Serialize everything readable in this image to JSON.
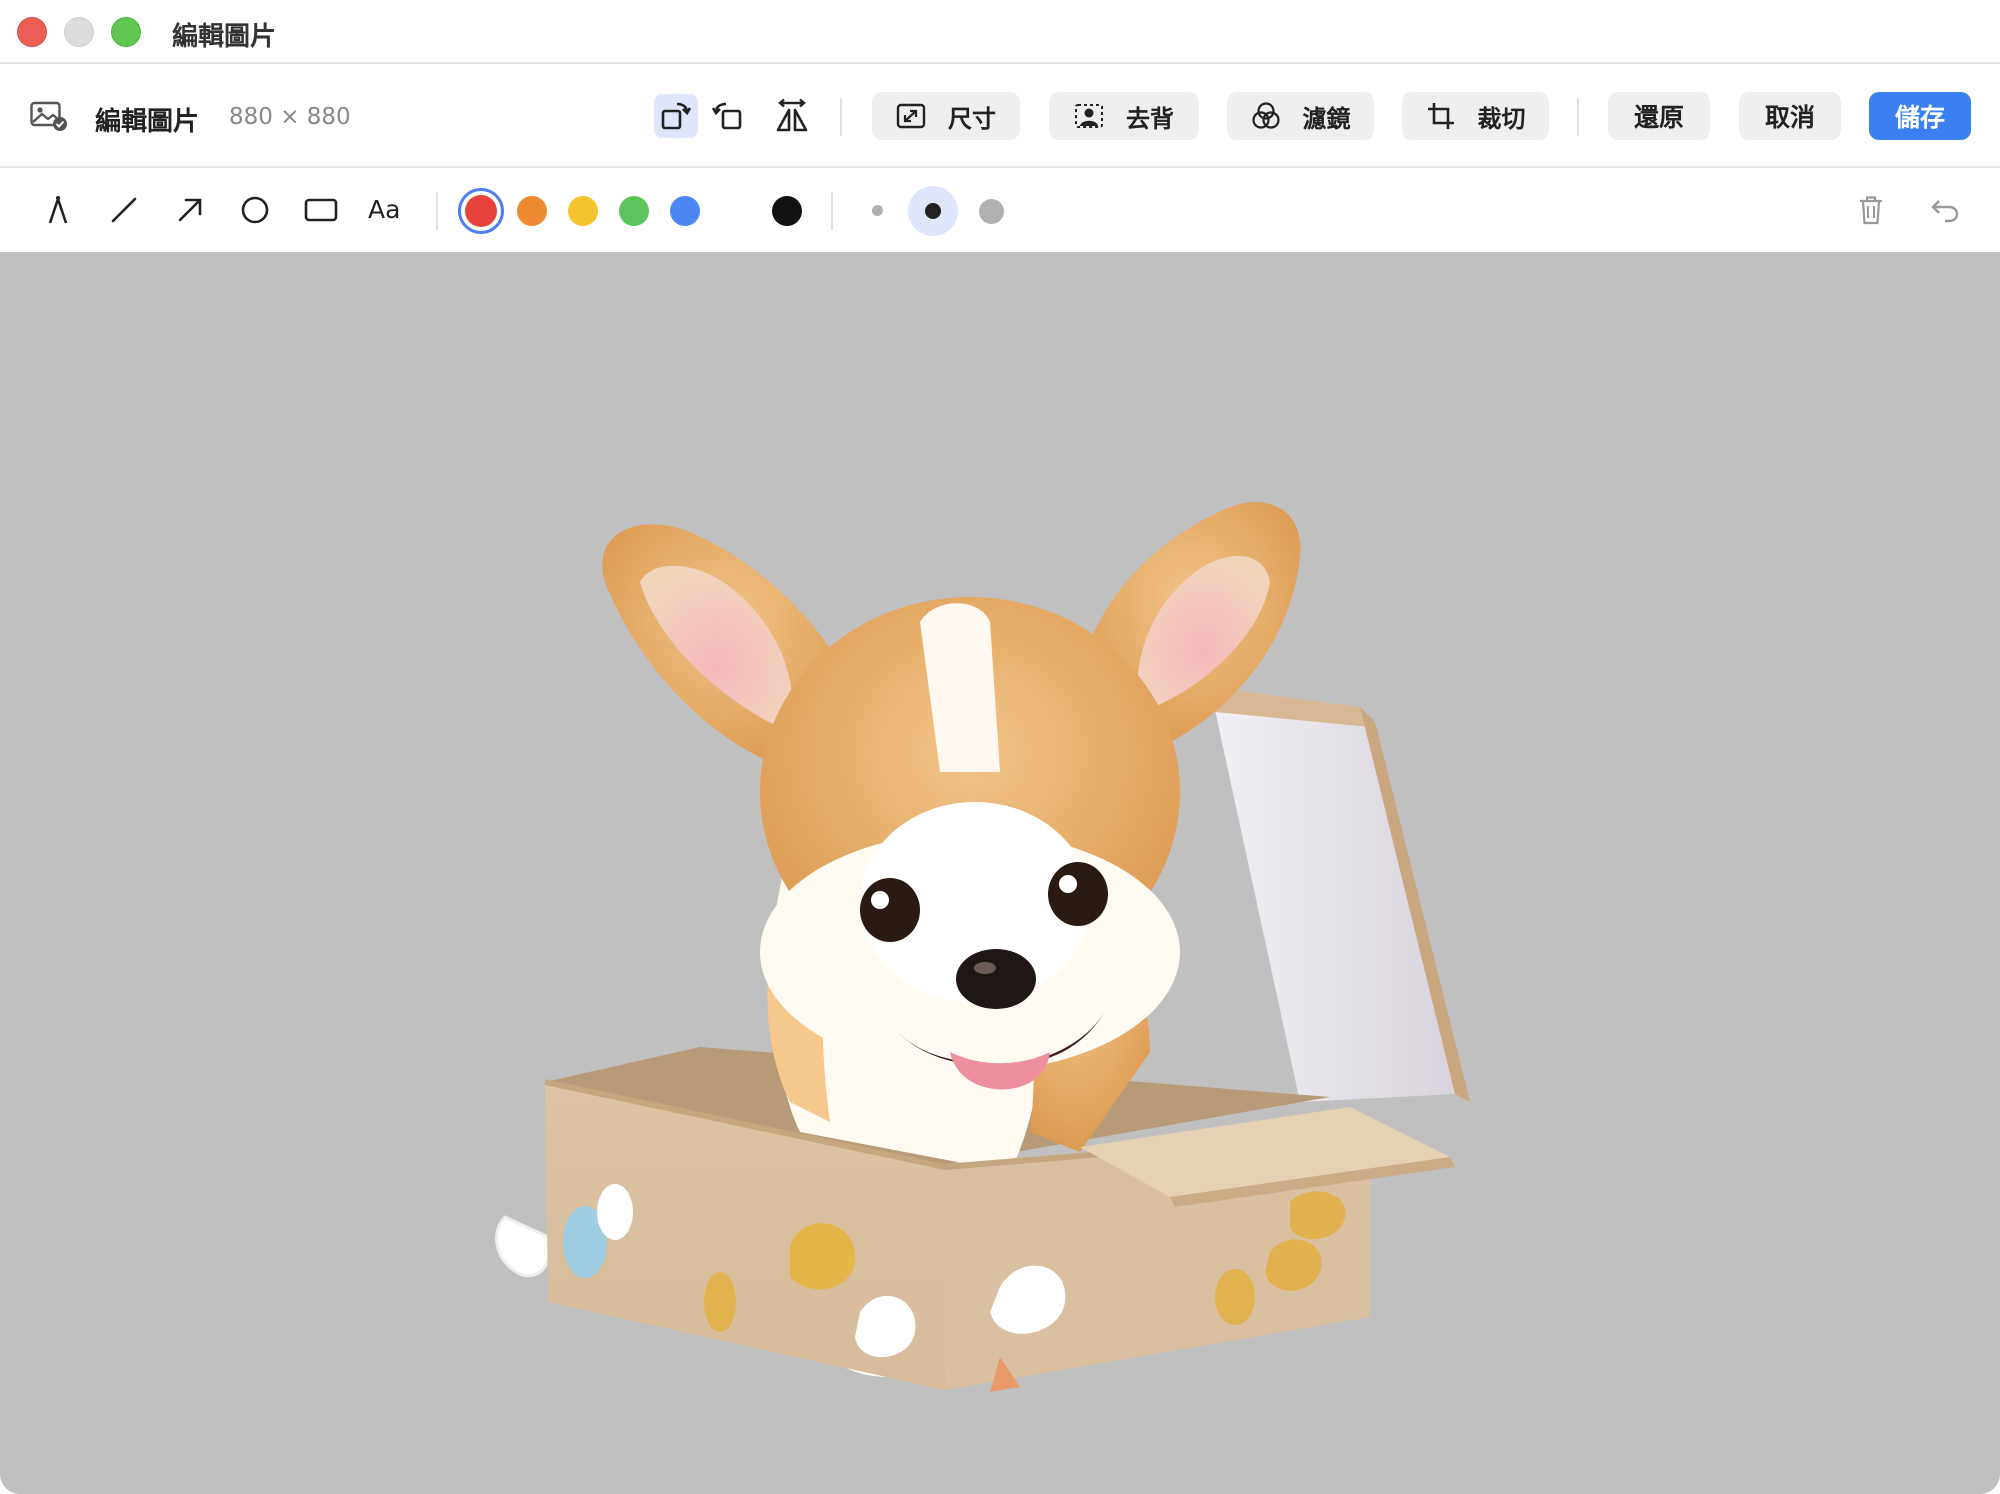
{
  "window": {
    "title": "編輯圖片",
    "controls": [
      "close",
      "minimize",
      "zoom"
    ]
  },
  "toolbar": {
    "doc_title": "編輯圖片",
    "doc_size": "880 × 880",
    "transform_icons": [
      "rotate-left-icon",
      "rotate-right-icon",
      "flip-horizontal-icon"
    ],
    "resize_label": "尺寸",
    "remove_bg_label": "去背",
    "filter_label": "濾鏡",
    "crop_label": "裁切",
    "revert_label": "還原",
    "cancel_label": "取消",
    "save_label": "儲存"
  },
  "annotation": {
    "tools": [
      "pen-icon",
      "line-icon",
      "arrow-icon",
      "ellipse-icon",
      "rectangle-icon",
      "text-tool"
    ],
    "text_tool_label": "Aa",
    "colors": [
      "#e8433b",
      "#ee8a31",
      "#f5c42e",
      "#5cc35d",
      "#4b86f2",
      "#111111"
    ],
    "selected_color": "#e8433b",
    "stroke_sizes": [
      "small",
      "medium",
      "large"
    ],
    "selected_stroke": "medium"
  },
  "canvas": {
    "background": "#c0c0c0",
    "image": "corgi-puppy-in-cardboard-box"
  },
  "colors": {
    "accent": "#3b7ff0",
    "active_bg": "#dfe6fb"
  }
}
